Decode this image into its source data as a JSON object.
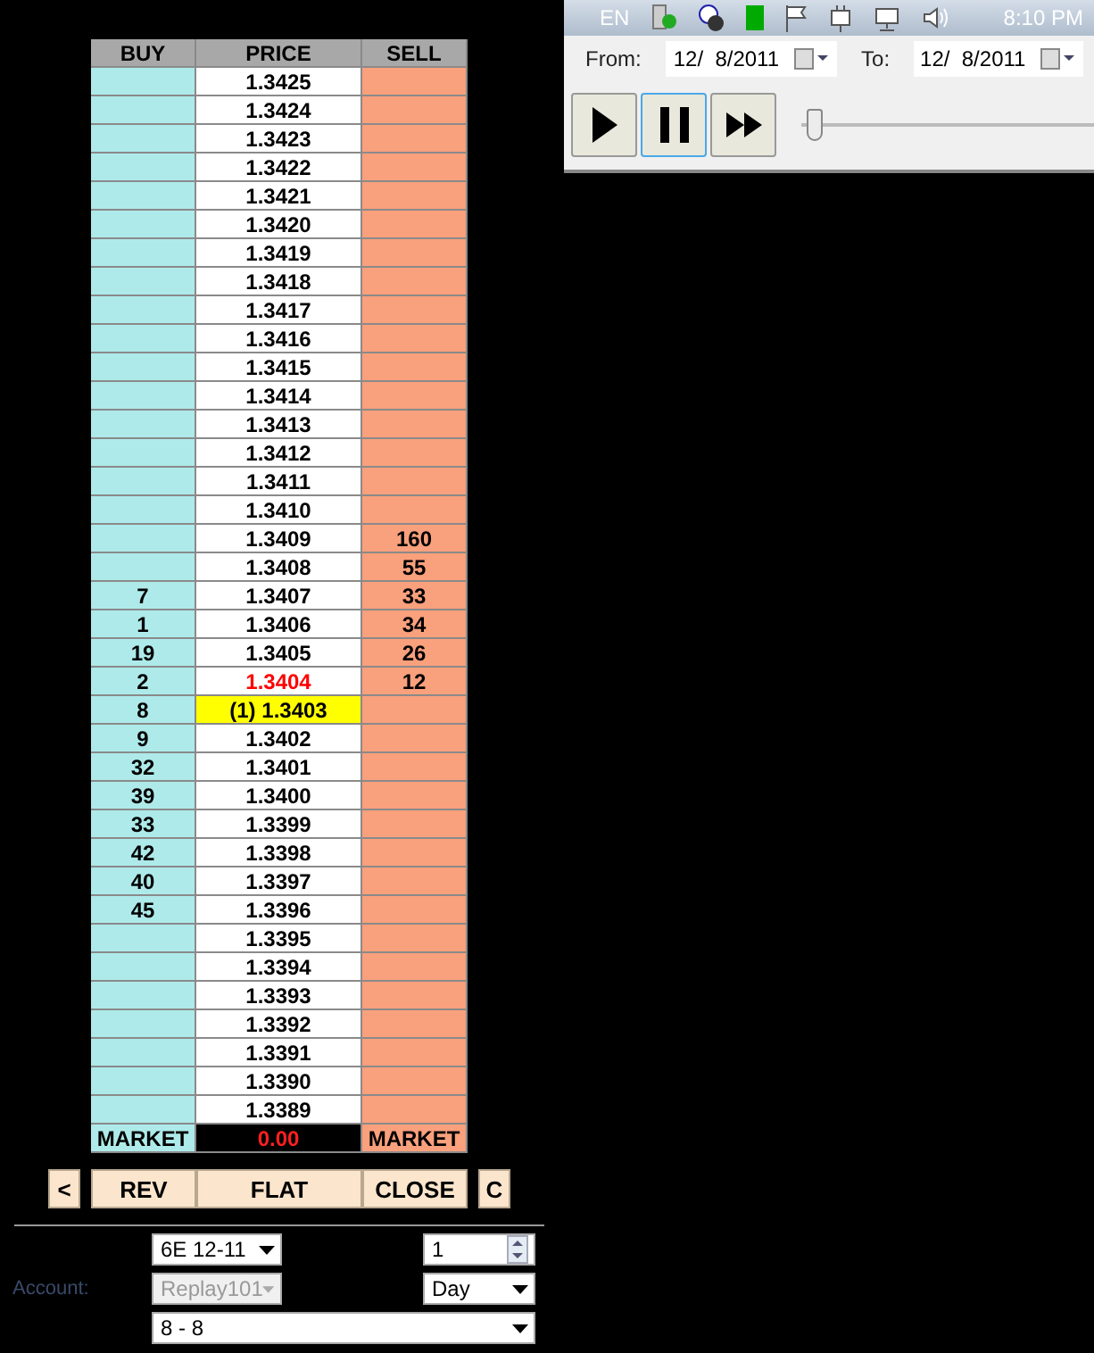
{
  "taskbar": {
    "language": "EN",
    "clock": "8:10 PM"
  },
  "replay": {
    "from_label": "From:",
    "from_date": "12/  8/2011",
    "to_label": "To:",
    "to_date": "12/  8/2011",
    "buttons": [
      {
        "kind": "play",
        "selected": false
      },
      {
        "kind": "pause",
        "selected": true
      },
      {
        "kind": "fast_forward",
        "selected": false
      }
    ],
    "slider": {
      "level": 0.02
    }
  },
  "ladder": {
    "columns": [
      "BUY",
      "PRICE",
      "SELL"
    ],
    "rows": [
      {
        "buy": "",
        "price": "1.3425",
        "sell": "",
        "kind": "normal"
      },
      {
        "buy": "",
        "price": "1.3424",
        "sell": "",
        "kind": "normal"
      },
      {
        "buy": "",
        "price": "1.3423",
        "sell": "",
        "kind": "normal"
      },
      {
        "buy": "",
        "price": "1.3422",
        "sell": "",
        "kind": "normal"
      },
      {
        "buy": "",
        "price": "1.3421",
        "sell": "",
        "kind": "normal"
      },
      {
        "buy": "",
        "price": "1.3420",
        "sell": "",
        "kind": "normal"
      },
      {
        "buy": "",
        "price": "1.3419",
        "sell": "",
        "kind": "normal"
      },
      {
        "buy": "",
        "price": "1.3418",
        "sell": "",
        "kind": "normal"
      },
      {
        "buy": "",
        "price": "1.3417",
        "sell": "",
        "kind": "normal"
      },
      {
        "buy": "",
        "price": "1.3416",
        "sell": "",
        "kind": "normal"
      },
      {
        "buy": "",
        "price": "1.3415",
        "sell": "",
        "kind": "normal"
      },
      {
        "buy": "",
        "price": "1.3414",
        "sell": "",
        "kind": "normal"
      },
      {
        "buy": "",
        "price": "1.3413",
        "sell": "",
        "kind": "normal"
      },
      {
        "buy": "",
        "price": "1.3412",
        "sell": "",
        "kind": "normal"
      },
      {
        "buy": "",
        "price": "1.3411",
        "sell": "",
        "kind": "normal"
      },
      {
        "buy": "",
        "price": "1.3410",
        "sell": "",
        "kind": "normal"
      },
      {
        "buy": "",
        "price": "1.3409",
        "sell": "160",
        "kind": "normal"
      },
      {
        "buy": "",
        "price": "1.3408",
        "sell": "55",
        "kind": "normal"
      },
      {
        "buy": "7",
        "price": "1.3407",
        "sell": "33",
        "kind": "normal"
      },
      {
        "buy": "1",
        "price": "1.3406",
        "sell": "34",
        "kind": "normal"
      },
      {
        "buy": "19",
        "price": "1.3405",
        "sell": "26",
        "kind": "normal"
      },
      {
        "buy": "2",
        "price": "1.3404",
        "sell": "12",
        "kind": "last"
      },
      {
        "buy": "8",
        "price": "(1) 1.3403",
        "sell": "",
        "kind": "position"
      },
      {
        "buy": "9",
        "price": "1.3402",
        "sell": "",
        "kind": "normal"
      },
      {
        "buy": "32",
        "price": "1.3401",
        "sell": "",
        "kind": "normal"
      },
      {
        "buy": "39",
        "price": "1.3400",
        "sell": "",
        "kind": "normal"
      },
      {
        "buy": "33",
        "price": "1.3399",
        "sell": "",
        "kind": "normal"
      },
      {
        "buy": "42",
        "price": "1.3398",
        "sell": "",
        "kind": "normal"
      },
      {
        "buy": "40",
        "price": "1.3397",
        "sell": "",
        "kind": "normal"
      },
      {
        "buy": "45",
        "price": "1.3396",
        "sell": "",
        "kind": "normal"
      },
      {
        "buy": "",
        "price": "1.3395",
        "sell": "",
        "kind": "normal"
      },
      {
        "buy": "",
        "price": "1.3394",
        "sell": "",
        "kind": "normal"
      },
      {
        "buy": "",
        "price": "1.3393",
        "sell": "",
        "kind": "normal"
      },
      {
        "buy": "",
        "price": "1.3392",
        "sell": "",
        "kind": "normal"
      },
      {
        "buy": "",
        "price": "1.3391",
        "sell": "",
        "kind": "normal"
      },
      {
        "buy": "",
        "price": "1.3390",
        "sell": "",
        "kind": "normal"
      },
      {
        "buy": "",
        "price": "1.3389",
        "sell": "",
        "kind": "normal"
      }
    ],
    "footer": {
      "buy": "MARKET",
      "pnl": "0.00",
      "sell": "MARKET"
    }
  },
  "actions": [
    "<",
    "REV",
    "FLAT",
    "CLOSE",
    "C"
  ],
  "order": {
    "instrument": "6E 12-11",
    "quantity": "1",
    "account_label": "Account:",
    "account": "Replay101",
    "account_disabled": true,
    "tif": "Day",
    "strategy": "8 - 8"
  }
}
